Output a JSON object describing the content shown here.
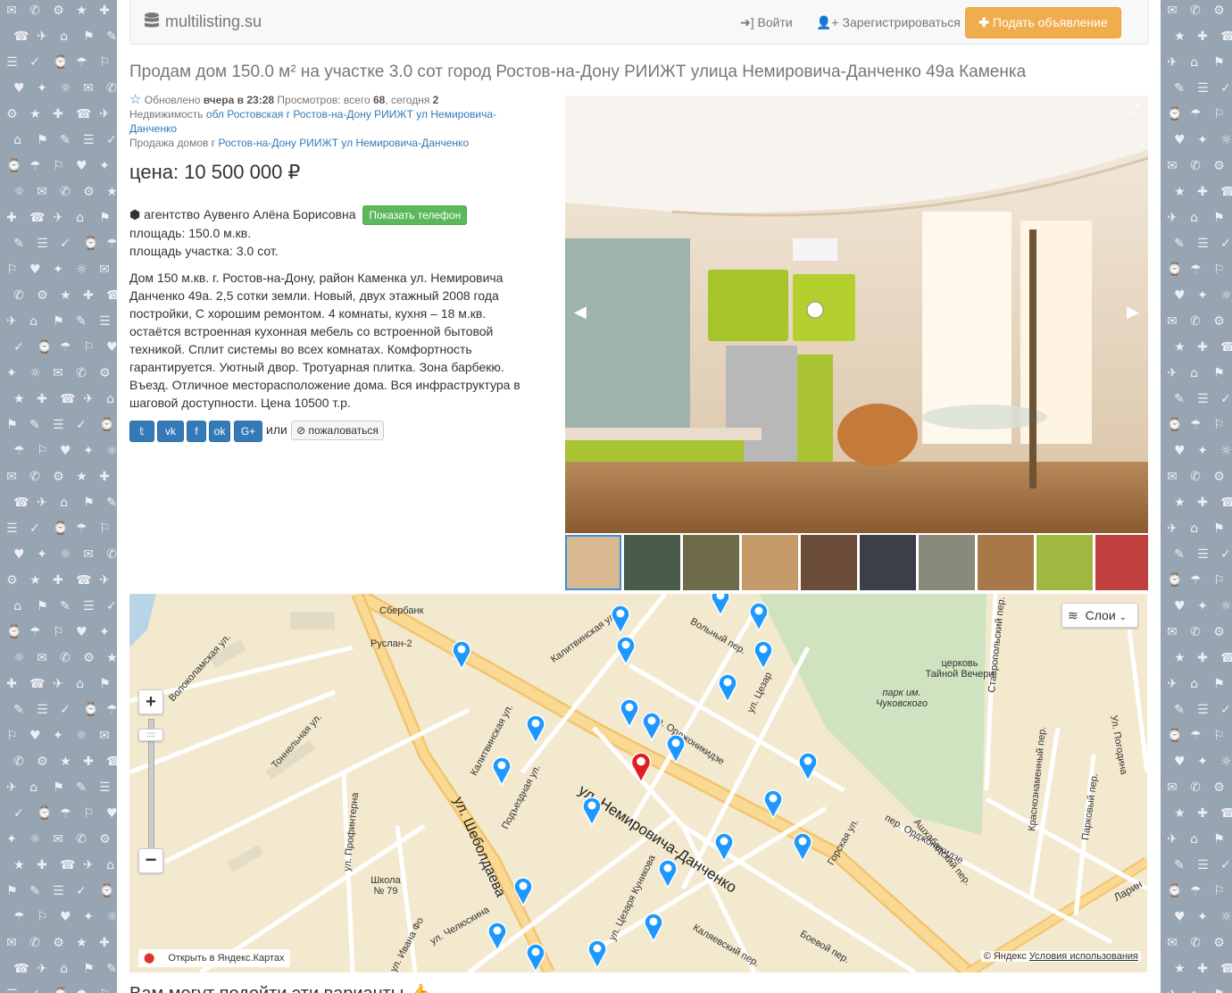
{
  "site": {
    "name": "multilisting.su"
  },
  "nav": {
    "login": "Войти",
    "register": "Зарегистрироваться",
    "add": "Подать объявление"
  },
  "listing": {
    "title": "Продам дом 150.0 м² на участке 3.0 сот город Ростов-на-Дону РИИЖТ улица Немировича-Данченко 49а Каменка",
    "updated_label": "Обновлено",
    "updated_value": "вчера в 23:28",
    "views_label": "Просмотров: всего",
    "views_total": "68",
    "views_today_label": ", сегодня",
    "views_today": "2",
    "category1_label": "Недвижимость",
    "category1_link": "обл Ростовская г Ростов-на-Дону РИИЖТ ул Немировича-Данченко",
    "category2_label": "Продажа домов",
    "category2_g": "г",
    "category2_link": "Ростов-на-Дону РИИЖТ ул Немировича-Данченко",
    "price": "цена: 10 500 000 ₽",
    "agency": "агентство Аувенго Алёна Борисовна",
    "show_phone": "Показать телефон",
    "area_house": "площадь: 150.0 м.кв.",
    "area_land": "площадь участка: 3.0 сот.",
    "description": "Дом 150 м.кв. г. Ростов-на-Дону, район Каменка ул. Немировича Данченко 49а. 2,5 сотки земли. Новый, двух этажный 2008 года постройки, С хорошим ремонтом. 4 комнаты, кухня – 18 м.кв. остаётся встроенная кухонная мебель со встроенной бытовой техникой. Сплит системы во всех комнатах. Комфортность гарантируется. Уютный двор. Тротуарная плитка. Зона барбекю. Въезд. Отличное месторасположение дома. Вся инфраструктура в шаговой доступности. Цена 10500 т.р.",
    "or": "или",
    "complain": "пожаловаться"
  },
  "map": {
    "layers": "Слои",
    "open_yandex": "Открыть в Яндекс.Картах",
    "copyright": "© Яндекс",
    "terms": "Условия использования",
    "labels": {
      "street_nemirovicha": "ул. Немировича-Данченко",
      "street_sheboldaeva": "ул. Шеболдаева",
      "street_kalitvinskaya": "Калитвинская ул.",
      "street_kalitvinskaya2": "Калитвинская ул.",
      "street_podezdnaya": "Подъездная ул.",
      "street_ordzh": "пер. Орджоникидзе",
      "street_ordzh2": "пер. Орджоникидзе",
      "street_volny": "Вольный пер.",
      "street_stavropolsky": "Ставропольский пер.",
      "street_ashkhabad": "Ашхабадский пер.",
      "street_gorskaya": "Горская ул.",
      "street_pogodina": "Ул. Погодина",
      "street_tonnelnaya": "Тоннельная ул.",
      "street_volokolamskaya": "Волоколамская ул.",
      "street_profinterna": "ул. Профинтерна",
      "street_chelyuskina": "ул. Челюскина",
      "street_kunikova": "ул. Цезаря Куникова",
      "street_kalyaevsky": "Каляевский пер.",
      "street_boevoy": "Боевой пер.",
      "street_krasnoznam": "Краснознаменный пер.",
      "street_parkovy": "Парковый пер.",
      "street_ivana_fo": "ул. Ивана Фо",
      "street_larin": "Ларин",
      "street_tsezar": "ул. Цезар",
      "sberbank": "Сбербанк",
      "ruslan": "Руслан-2",
      "church": "церковь Тайной Вечери",
      "park": "парк им. Чуковского",
      "school": "Школа № 79"
    }
  },
  "bottom": {
    "title": "Вам могут подойти эти варианты"
  },
  "colors": {
    "brand_orange": "#f0ad4e",
    "phone_green": "#5cb85c",
    "link_blue": "#337ab7",
    "map_park": "#cfe3c0"
  }
}
